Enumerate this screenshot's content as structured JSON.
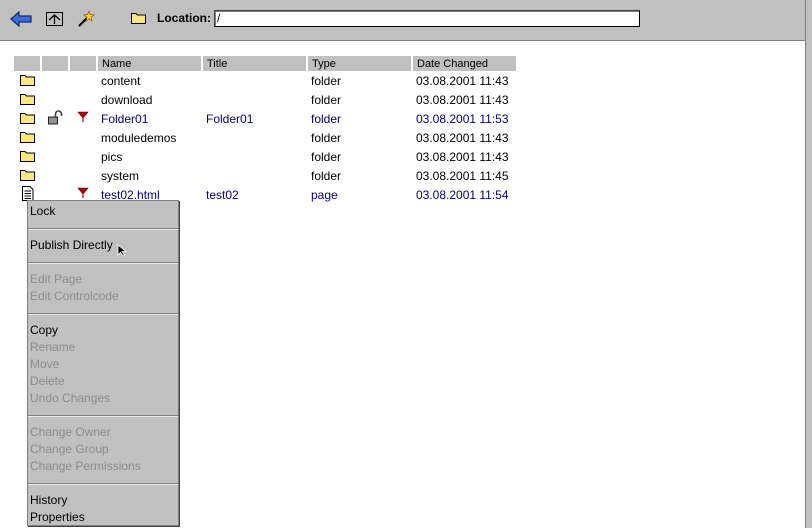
{
  "toolbar": {
    "back_icon": "back-arrow-icon",
    "up_icon": "up-folder-icon",
    "new_icon": "new-wand-icon",
    "location_label": "Location:",
    "location_value": "/"
  },
  "table": {
    "headers": [
      "Name",
      "Title",
      "Type",
      "Date Changed"
    ],
    "rows": [
      {
        "icon": "folder",
        "locked": false,
        "flag": false,
        "state": "normal",
        "name": "content",
        "title": "",
        "type": "folder",
        "date": "03.08.2001 11:43"
      },
      {
        "icon": "folder",
        "locked": false,
        "flag": false,
        "state": "normal",
        "name": "download",
        "title": "",
        "type": "folder",
        "date": "03.08.2001 11:43"
      },
      {
        "icon": "folder",
        "locked": true,
        "flag": true,
        "state": "modified",
        "name": "Folder01",
        "title": "Folder01",
        "type": "folder",
        "date": "03.08.2001 11:53"
      },
      {
        "icon": "folder",
        "locked": false,
        "flag": false,
        "state": "normal",
        "name": "moduledemos",
        "title": "",
        "type": "folder",
        "date": "03.08.2001 11:43"
      },
      {
        "icon": "folder",
        "locked": false,
        "flag": false,
        "state": "normal",
        "name": "pics",
        "title": "",
        "type": "folder",
        "date": "03.08.2001 11:43"
      },
      {
        "icon": "folder",
        "locked": false,
        "flag": false,
        "state": "normal",
        "name": "system",
        "title": "",
        "type": "folder",
        "date": "03.08.2001 11:45"
      },
      {
        "icon": "page",
        "locked": false,
        "flag": true,
        "state": "modified",
        "name": "test02.html",
        "title": "test02",
        "type": "page",
        "date": "03.08.2001 11:54"
      }
    ]
  },
  "context_menu": {
    "groups": [
      [
        {
          "label": "Lock",
          "enabled": true
        }
      ],
      [
        {
          "label": "Publish Directly",
          "enabled": true
        }
      ],
      [
        {
          "label": "Edit Page",
          "enabled": false
        },
        {
          "label": "Edit Controlcode",
          "enabled": false
        }
      ],
      [
        {
          "label": "Copy",
          "enabled": true
        },
        {
          "label": "Rename",
          "enabled": false
        },
        {
          "label": "Move",
          "enabled": false
        },
        {
          "label": "Delete",
          "enabled": false
        },
        {
          "label": "Undo Changes",
          "enabled": false
        }
      ],
      [
        {
          "label": "Change Owner",
          "enabled": false
        },
        {
          "label": "Change Group",
          "enabled": false
        },
        {
          "label": "Change Permissions",
          "enabled": false
        }
      ],
      [
        {
          "label": "History",
          "enabled": true
        },
        {
          "label": "Properties",
          "enabled": true
        }
      ]
    ]
  },
  "colors": {
    "chrome": "#c0c0c0",
    "modified_text": "#000080",
    "disabled_text": "#8d8d8d",
    "folder_yellow": "#ffe680",
    "flag_red": "#b00000"
  }
}
